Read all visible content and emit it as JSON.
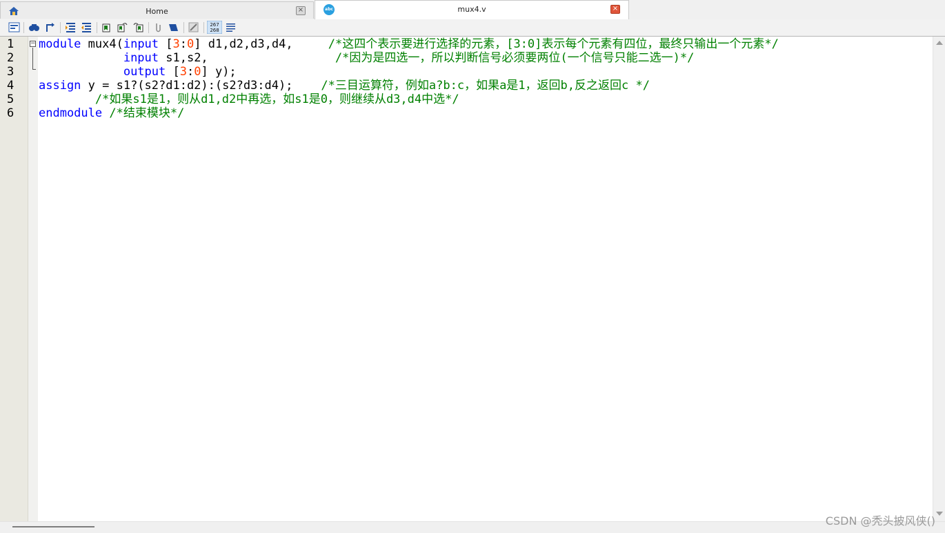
{
  "tabs": [
    {
      "label": "Home",
      "icon": "home-icon",
      "active": false
    },
    {
      "label": "mux4.v",
      "icon": "abc-file-icon",
      "active": true
    }
  ],
  "toolbar": {
    "icons": [
      "column-view-icon",
      "find-icon",
      "goto-icon",
      "indent-icon",
      "outdent-icon",
      "bookmark-icon",
      "bookmark-next-icon",
      "bookmark-prev-icon",
      "attach-icon",
      "mark-icon",
      "compare-icon",
      "line-numbers-icon",
      "word-wrap-icon"
    ]
  },
  "editor": {
    "line_numbers": [
      "1",
      "2",
      "3",
      "4",
      "5",
      "6"
    ],
    "lines": [
      [
        {
          "t": "module",
          "c": "kw"
        },
        {
          "t": " mux4(",
          "c": ""
        },
        {
          "t": "input",
          "c": "kw"
        },
        {
          "t": " [",
          "c": ""
        },
        {
          "t": "3",
          "c": "num"
        },
        {
          "t": ":",
          "c": ""
        },
        {
          "t": "0",
          "c": "num"
        },
        {
          "t": "] d1,d2,d3,d4,     ",
          "c": ""
        },
        {
          "t": "/*这四个表示要进行选择的元素，[3:0]表示每个元素有四位，最终只输出一个元素*/",
          "c": "cm"
        }
      ],
      [
        {
          "t": "            ",
          "c": ""
        },
        {
          "t": "input",
          "c": "kw"
        },
        {
          "t": " s1,s2,                  ",
          "c": ""
        },
        {
          "t": "/*因为是四选一，所以判断信号必须要两位(一个信号只能二选一)*/",
          "c": "cm"
        }
      ],
      [
        {
          "t": "            ",
          "c": ""
        },
        {
          "t": "output",
          "c": "kw"
        },
        {
          "t": " [",
          "c": ""
        },
        {
          "t": "3",
          "c": "num"
        },
        {
          "t": ":",
          "c": ""
        },
        {
          "t": "0",
          "c": "num"
        },
        {
          "t": "] y);",
          "c": ""
        }
      ],
      [
        {
          "t": "assign",
          "c": "kw"
        },
        {
          "t": " y = s1?(s2?d1:d2):(s2?d3:d4);    ",
          "c": ""
        },
        {
          "t": "/*三目运算符，例如a?b:c，如果a是1，返回b,反之返回c */",
          "c": "cm"
        }
      ],
      [
        {
          "t": "        ",
          "c": ""
        },
        {
          "t": "/*如果s1是1，则从d1,d2中再选，如s1是0，则继续从d3,d4中选*/",
          "c": "cm"
        }
      ],
      [
        {
          "t": "endmodule",
          "c": "kw"
        },
        {
          "t": " ",
          "c": ""
        },
        {
          "t": "/*结束模块*/",
          "c": "cm"
        }
      ]
    ]
  },
  "watermark": "CSDN @秃头披风侠()",
  "colors": {
    "keyword": "#0000ff",
    "number": "#ff4000",
    "comment": "#008000",
    "gutter": "#eae9e1"
  }
}
